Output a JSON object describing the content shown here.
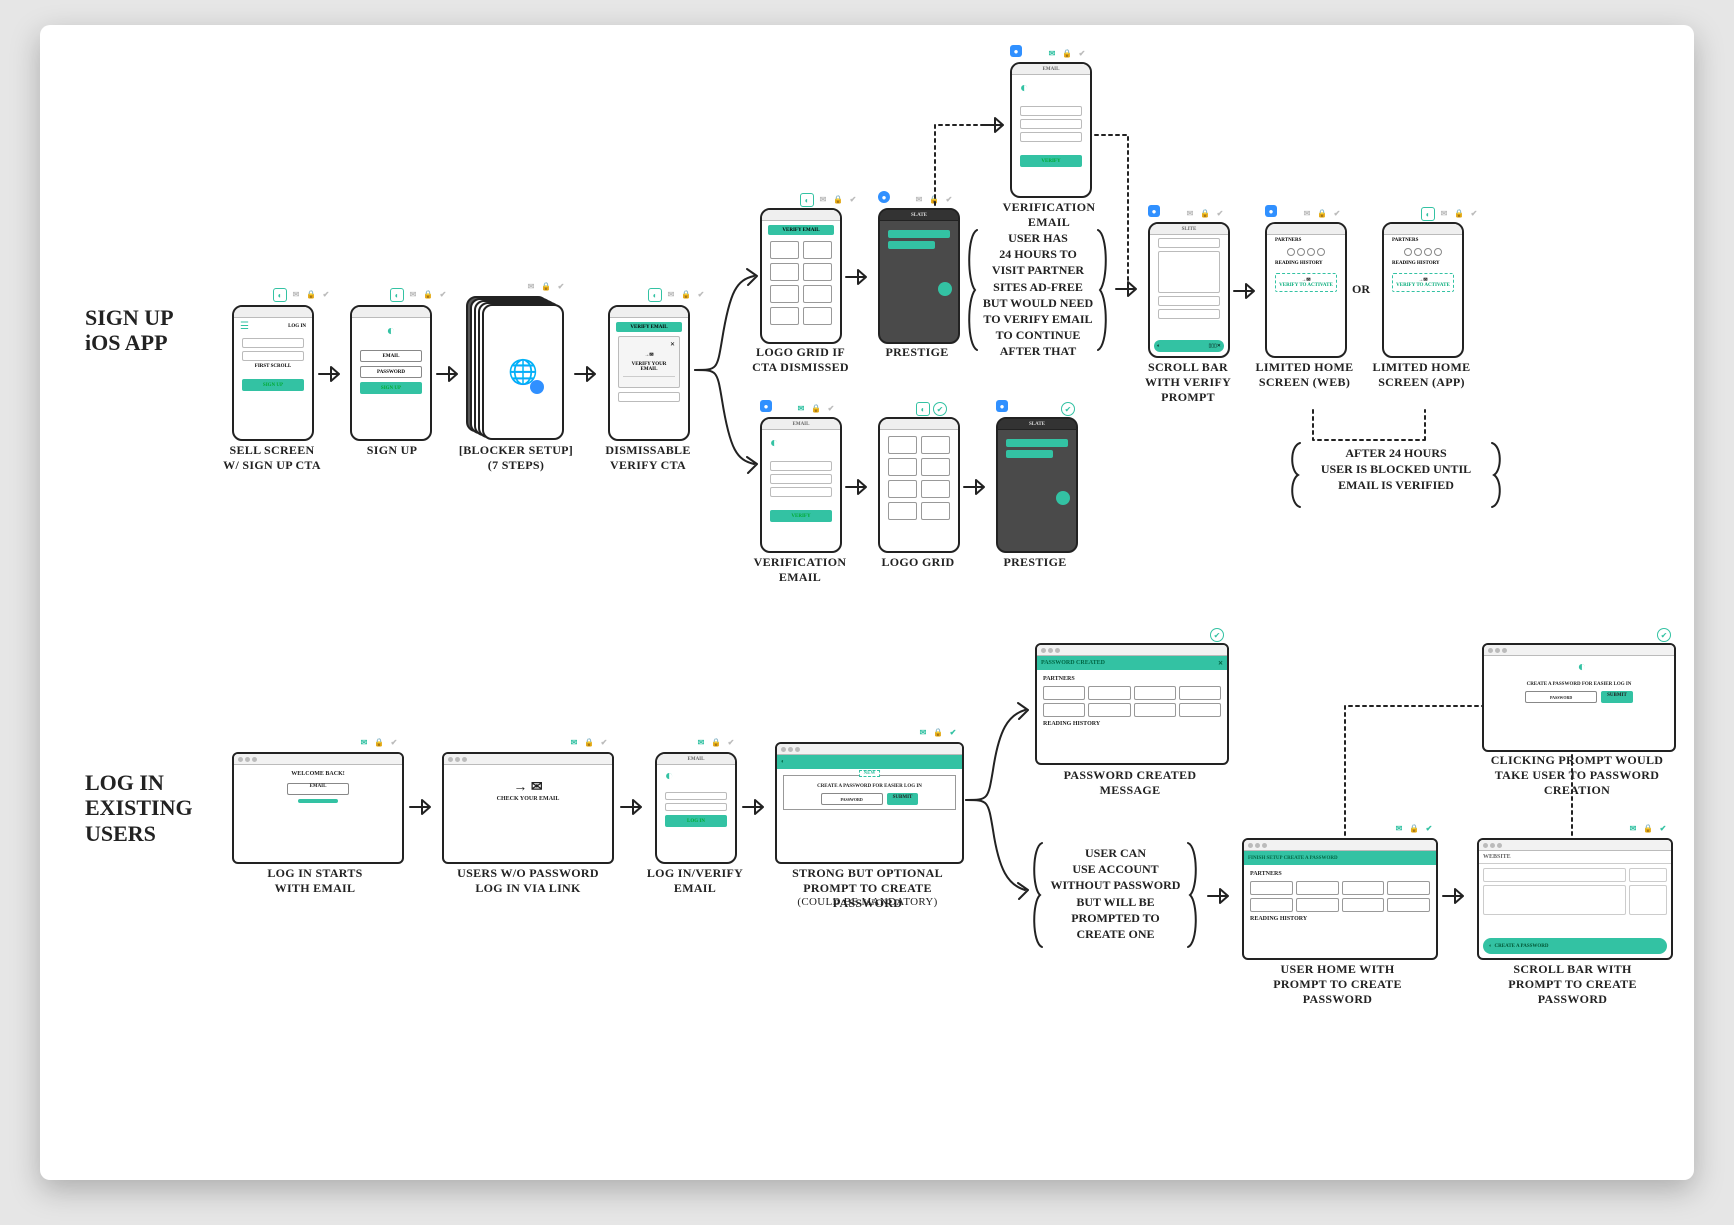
{
  "flow1": {
    "title": "SIGN UP\niOS APP",
    "sell_cap": "SELL SCREEN W/ SIGN UP CTA",
    "signup_cap": "SIGN UP",
    "blocker_cap": "[BLOCKER SETUP]\n(7 STEPS)",
    "verify_cta_cap": "DISMISSABLE VERIFY CTA",
    "grid_cap": "LOGO GRID IF CTA DISMISSED",
    "prestige_cap": "PRESTIGE",
    "verify_email_cap": "VERIFICATION EMAIL",
    "verify_email_top_cap": "VERIFICATION EMAIL",
    "grid_bot_cap": "LOGO GRID",
    "prestige_bot_cap": "PRESTIGE",
    "scroll_cap": "SCROLL BAR WITH VERIFY PROMPT",
    "limited_web_cap": "LIMITED HOME SCREEN (WEB)",
    "limited_app_cap": "LIMITED HOME SCREEN (APP)",
    "or": "OR",
    "note24": "USER HAS\n24 HOURS TO\nVISIT PARTNER\nSITES AD-FREE\nBUT WOULD NEED\nTO VERIFY EMAIL\nTO CONTINUE\nAFTER THAT",
    "after24": "AFTER 24 HOURS\nUSER IS BLOCKED UNTIL\nEMAIL IS VERIFIED",
    "ui": {
      "sell_login": "LOG IN",
      "sell_scroll": "FIRST SCROLL",
      "sell_signup": "SIGN UP",
      "signup_email": "EMAIL",
      "signup_password": "PASSWORD",
      "signup_btn": "SIGN UP",
      "verify_head": "VERIFY EMAIL",
      "verify_msg": "VERIFY YOUR EMAIL",
      "email_head": "EMAIL",
      "verify_btn": "VERIFY",
      "slite": "SLITE",
      "slate": "SLATE",
      "partners": "PARTNERS",
      "reading": "READING HISTORY",
      "verify_activate": "VERIFY TO ACTIVATE"
    }
  },
  "flow2": {
    "title": "LOG IN\nEXISTING\nUSERS",
    "login_cap": "LOG IN STARTS WITH EMAIL",
    "check_cap": "USERS W/O PASSWORD LOG IN VIA LINK",
    "verify_cap": "LOG IN/VERIFY EMAIL",
    "prompt_cap": "STRONG BUT OPTIONAL PROMPT TO CREATE PASSWORD",
    "prompt_sub": "(COULD BE MANDATORY)",
    "pw_created_cap": "PASSWORD CREATED MESSAGE",
    "home_prompt_cap": "USER HOME WITH PROMPT TO CREATE PASSWORD",
    "scroll_prompt_cap": "SCROLL BAR WITH PROMPT TO CREATE PASSWORD",
    "click_cap": "CLICKING PROMPT WOULD TAKE USER TO PASSWORD CREATION",
    "note_nopw": "USER CAN\nUSE ACCOUNT\nWITHOUT PASSWORD\nBUT WILL BE\nPROMPTED TO\nCREATE ONE",
    "ui": {
      "welcome": "WELCOME BACK!",
      "email": "EMAIL",
      "check_email": "CHECK YOUR EMAIL",
      "email_head": "EMAIL",
      "login_btn": "LOG IN",
      "new": "NEW",
      "create_pw": "CREATE A PASSWORD FOR EASIER LOG IN",
      "pw_label": "PASSWORD",
      "submit": "SUBMIT",
      "pw_created": "PASSWORD CREATED",
      "partners": "PARTNERS",
      "reading": "READING HISTORY",
      "finish_setup": "FINISH SETUP CREATE A PASSWORD",
      "website": "WEBSITE",
      "create_prompt": "CREATE A PASSWORD"
    }
  }
}
